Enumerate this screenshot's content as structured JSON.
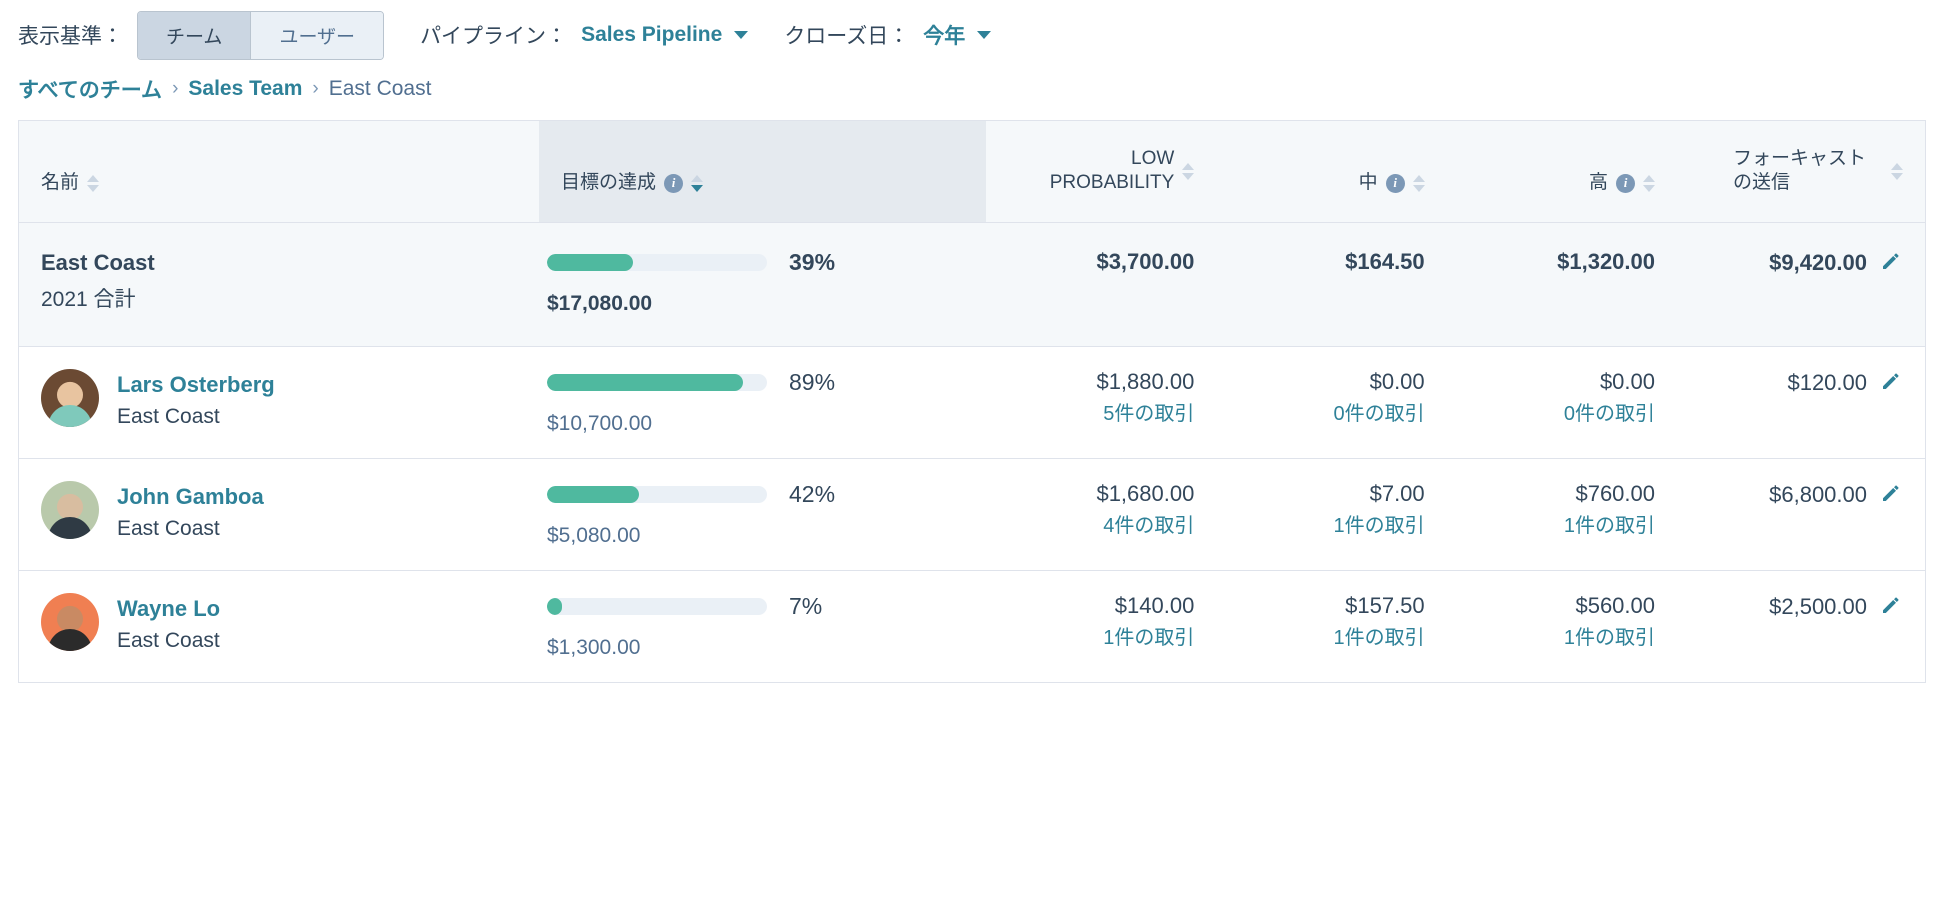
{
  "filters": {
    "view_by_label": "表示基準：",
    "segments": [
      {
        "label": "チーム",
        "active": true
      },
      {
        "label": "ユーザー",
        "active": false
      }
    ],
    "pipeline_label": "パイプライン：",
    "pipeline_value": "Sales Pipeline",
    "close_date_label": "クローズ日：",
    "close_date_value": "今年"
  },
  "breadcrumb": {
    "items": [
      {
        "label": "すべてのチーム",
        "current": false
      },
      {
        "label": "Sales Team",
        "current": false
      },
      {
        "label": "East Coast",
        "current": true
      }
    ],
    "separator": "›"
  },
  "table": {
    "headers": {
      "name": "名前",
      "goal": "目標の達成",
      "low": "LOW PROBABILITY",
      "medium": "中",
      "high": "高",
      "forecast": "フォーキャストの送信"
    },
    "info_glyph": "i",
    "summary": {
      "title": "East Coast",
      "subtitle": "2021 合計",
      "goal_percent": "39%",
      "goal_fill": 39,
      "goal_amount": "$17,080.00",
      "low": "$3,700.00",
      "medium": "$164.50",
      "high": "$1,320.00",
      "forecast": "$9,420.00"
    },
    "rows": [
      {
        "name": "Lars Osterberg",
        "team": "East Coast",
        "avatar": {
          "bg": "#6b4a33",
          "skin": "#e8c4a0",
          "shirt": "#7fc9bb"
        },
        "goal_percent": "89%",
        "goal_fill": 89,
        "goal_amount": "$10,700.00",
        "low": "$1,880.00",
        "low_deals": "5件の取引",
        "medium": "$0.00",
        "medium_deals": "0件の取引",
        "high": "$0.00",
        "high_deals": "0件の取引",
        "forecast": "$120.00"
      },
      {
        "name": "John Gamboa",
        "team": "East Coast",
        "avatar": {
          "bg": "#b9c9ab",
          "skin": "#d8bda0",
          "shirt": "#2f3a44"
        },
        "goal_percent": "42%",
        "goal_fill": 42,
        "goal_amount": "$5,080.00",
        "low": "$1,680.00",
        "low_deals": "4件の取引",
        "medium": "$7.00",
        "medium_deals": "1件の取引",
        "high": "$760.00",
        "high_deals": "1件の取引",
        "forecast": "$6,800.00"
      },
      {
        "name": "Wayne Lo",
        "team": "East Coast",
        "avatar": {
          "bg": "#f07f52",
          "skin": "#c98a63",
          "shirt": "#2b2b2b"
        },
        "goal_percent": "7%",
        "goal_fill": 7,
        "goal_amount": "$1,300.00",
        "low": "$140.00",
        "low_deals": "1件の取引",
        "medium": "$157.50",
        "medium_deals": "1件の取引",
        "high": "$560.00",
        "high_deals": "1件の取引",
        "forecast": "$2,500.00"
      }
    ]
  },
  "colors": {
    "link": "#2e8198",
    "bar_fill": "#4fb99f",
    "bar_track": "#eaf0f6",
    "text": "#33475b",
    "header_bg": "#f5f8fa",
    "sorted_header_bg": "#e5eaef"
  }
}
